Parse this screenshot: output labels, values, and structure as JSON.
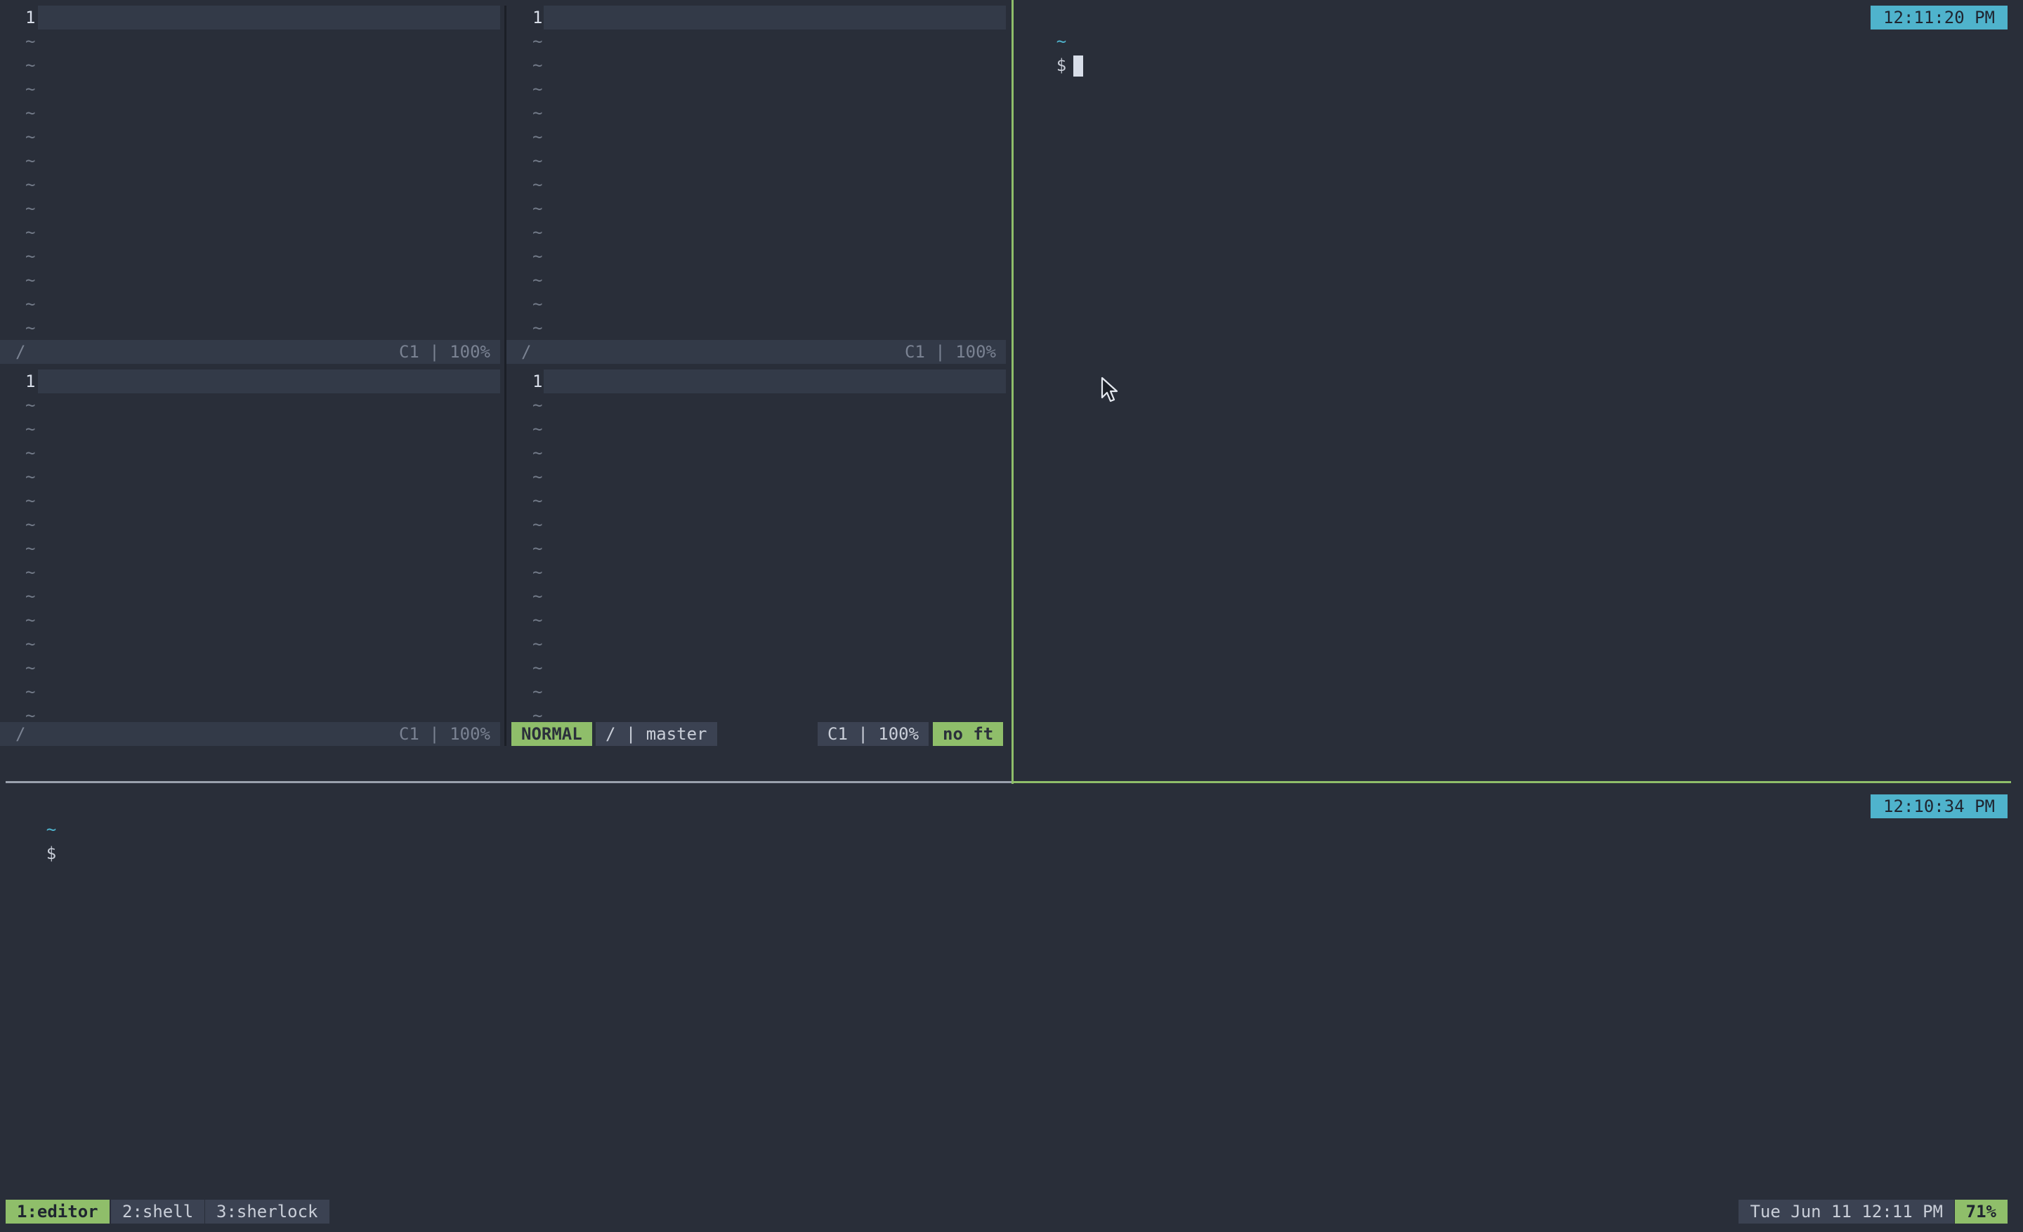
{
  "vim": {
    "line_number": "1",
    "tilde": "~",
    "pane_top_left": {
      "status_slash": "/",
      "status_pos": "C1 | 100%"
    },
    "pane_top_right": {
      "status_slash": "/",
      "status_pos": "C1 | 100%"
    },
    "pane_bottom_left": {
      "status_slash": "/",
      "status_pos": "C1 | 100%"
    },
    "pane_bottom_right": {
      "mode": "NORMAL",
      "path": "/ | master",
      "status_pos": "C1 | 100%",
      "filetype": "no ft"
    }
  },
  "shell_top": {
    "prompt_tilde": "~",
    "prompt_dollar": "$",
    "clock": "12:11:20 PM"
  },
  "shell_bottom": {
    "prompt_tilde": "~",
    "prompt_dollar": "$",
    "clock": "12:10:34 PM"
  },
  "tmux": {
    "windows": [
      {
        "label": "1:editor",
        "active": true
      },
      {
        "label": "2:shell",
        "active": false
      },
      {
        "label": "3:sherlock",
        "active": false
      }
    ],
    "datetime": "Tue Jun 11 12:11 PM",
    "battery": "71%"
  },
  "colors": {
    "background": "#292e39",
    "accent_green": "#8fbe6a",
    "accent_cyan": "#4fb3cc",
    "statusline_bg": "#333a48"
  },
  "icons": {
    "mouse_pointer": "mouse-pointer-icon"
  }
}
